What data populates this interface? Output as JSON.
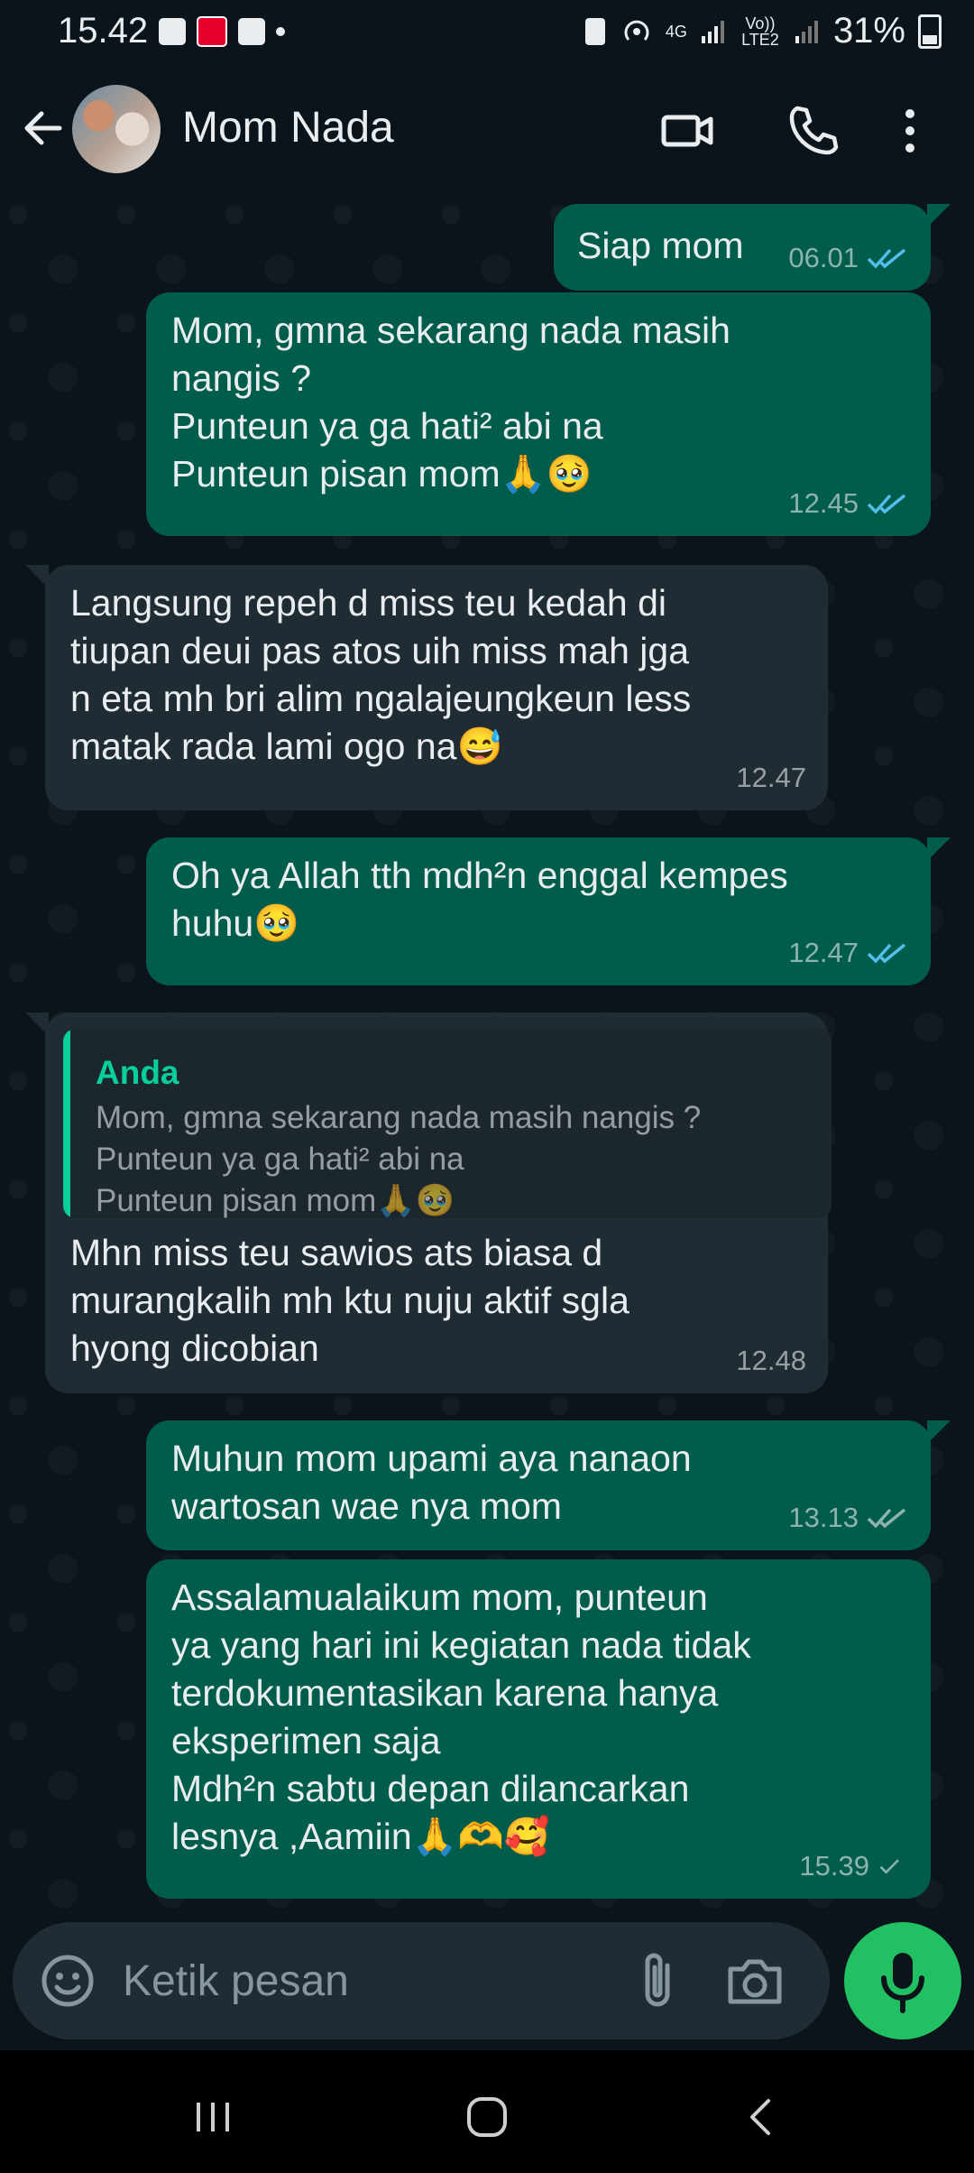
{
  "status_bar": {
    "time": "15.42",
    "network_4g": "4G",
    "volte": "Vo)) LTE2",
    "battery": "31%"
  },
  "header": {
    "contact_name": "Mom Nada"
  },
  "messages": [
    {
      "id": "m1",
      "type": "out",
      "text": "Siap mom",
      "time": "06.01",
      "status": "read"
    },
    {
      "id": "m2",
      "type": "out",
      "text": "Mom, gmna sekarang nada masih\nnangis ?\nPunteun ya ga hati² abi na\nPunteun pisan mom🙏🥹",
      "time": "12.45",
      "status": "read"
    },
    {
      "id": "m3",
      "type": "in",
      "text": "Langsung repeh d miss teu kedah di\ntiupan deui pas atos uih miss mah jga\nn eta mh bri alim ngalajeungkeun less\nmatak rada lami ogo na😅",
      "time": "12.47"
    },
    {
      "id": "m4",
      "type": "out",
      "text": "Oh ya Allah tth mdh²n enggal kempes\nhuhu🥹",
      "time": "12.47",
      "status": "read"
    },
    {
      "id": "m5",
      "type": "in",
      "quote_author": "Anda",
      "quote_text": "Mom, gmna sekarang nada masih nangis ?\nPunteun ya ga hati² abi na\nPunteun pisan mom🙏🥹",
      "text": "Mhn miss teu sawios ats biasa d\nmurangkalih mh ktu nuju aktif sgla\nhyong dicobian",
      "time": "12.48"
    },
    {
      "id": "m6",
      "type": "out",
      "text": "Muhun mom upami aya nanaon\nwartosan wae nya mom",
      "time": "13.13",
      "status": "delivered"
    },
    {
      "id": "m7",
      "type": "out",
      "text": "Assalamualaikum mom, punteun\nya yang hari ini kegiatan nada tidak\nterdokumentasikan karena hanya\neksperimen saja\nMdh²n sabtu depan dilancarkan\nlesnya ,Aamiin🙏🫶🥰",
      "time": "15.39",
      "status": "sent"
    }
  ],
  "composer": {
    "placeholder": "Ketik pesan"
  },
  "colors": {
    "bg": "#0b141a",
    "outgoing": "#005c4b",
    "incoming": "#202c33",
    "accent": "#21c063",
    "read_tick": "#53bdeb"
  }
}
